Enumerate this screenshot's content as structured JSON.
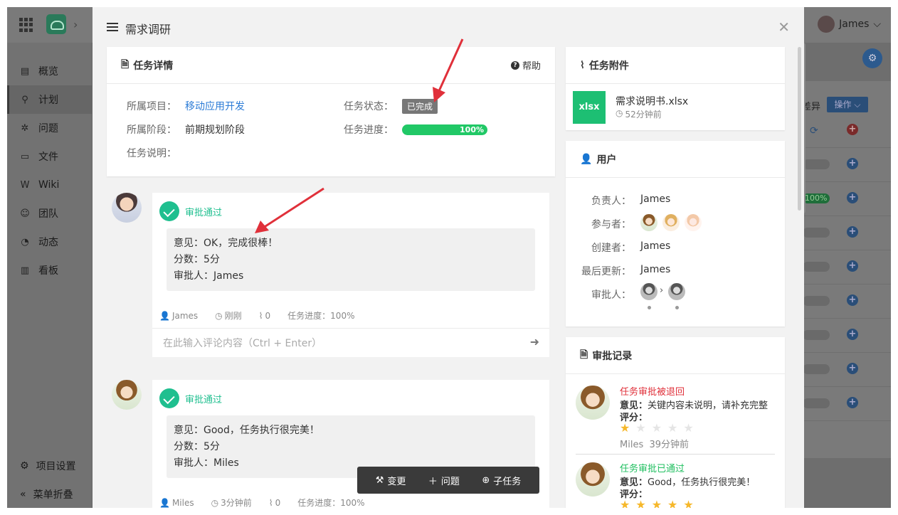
{
  "app": {
    "user_name": "James",
    "sidebar": {
      "items": [
        {
          "label": "概览",
          "icon": "overview-icon"
        },
        {
          "label": "计划",
          "icon": "plan-icon"
        },
        {
          "label": "问题",
          "icon": "bug-icon"
        },
        {
          "label": "文件",
          "icon": "folder-icon"
        },
        {
          "label": "Wiki",
          "icon": "wiki-icon"
        },
        {
          "label": "团队",
          "icon": "team-icon"
        },
        {
          "label": "动态",
          "icon": "activity-icon"
        },
        {
          "label": "看板",
          "icon": "chart-icon"
        }
      ],
      "project_settings": "项目设置",
      "collapse_menu": "菜单折叠"
    },
    "bg_panel": {
      "text_fragment": "差异",
      "operate_button": "操作",
      "progress_label": "100%"
    }
  },
  "modal": {
    "title": "需求调研",
    "task_detail": {
      "heading": "任务详情",
      "help_label": "帮助",
      "project_label": "所属项目：",
      "project_value": "移动应用开发",
      "stage_label": "所属阶段：",
      "stage_value": "前期规划阶段",
      "desc_label": "任务说明：",
      "status_label": "任务状态：",
      "status_value": "已完成",
      "progress_label": "任务进度：",
      "progress_value": "100%",
      "progress_fraction": 1.0
    },
    "approvals": [
      {
        "title": "审批通过",
        "opinion": "意见：OK，完成很棒！",
        "score": "分数：5分",
        "approver": "审批人：James",
        "meta_user": "James",
        "meta_time": "刚刚",
        "meta_attachments": "0",
        "meta_progress": "任务进度：100%",
        "comment_placeholder": "在此输入评论内容（Ctrl + Enter）"
      },
      {
        "title": "审批通过",
        "opinion": "意见：Good，任务执行很完美！",
        "score": "分数：5分",
        "approver": "审批人：Miles",
        "meta_user": "Miles",
        "meta_time": "3分钟前",
        "meta_attachments": "0",
        "meta_progress": "任务进度：100%"
      }
    ],
    "attachments": {
      "heading": "任务附件",
      "file_badge": "xlsx",
      "file_name": "需求说明书.xlsx",
      "file_time": "52分钟前"
    },
    "users": {
      "heading": "用户",
      "owner_label": "负责人：",
      "owner_value": "James",
      "participants_label": "参与者：",
      "creator_label": "创建者：",
      "creator_value": "James",
      "updated_label": "最后更新：",
      "updated_value": "James",
      "approver_label": "审批人："
    },
    "approval_records": {
      "heading": "审批记录",
      "items": [
        {
          "status": "任务审批被退回",
          "status_color": "#e0303a",
          "opinion_label": "意见：",
          "opinion_text": "关键内容未说明，请补充完整",
          "score_label": "评分：",
          "stars": 1,
          "user": "Miles",
          "time": "39分钟前"
        },
        {
          "status": "任务审批已通过",
          "status_color": "#1fbf5f",
          "opinion_label": "意见：",
          "opinion_text": "Good，任务执行很完美！",
          "score_label": "评分：",
          "stars": 5
        }
      ]
    },
    "toolbar": {
      "change": "变更",
      "issue": "问题",
      "subtask": "子任务"
    }
  }
}
